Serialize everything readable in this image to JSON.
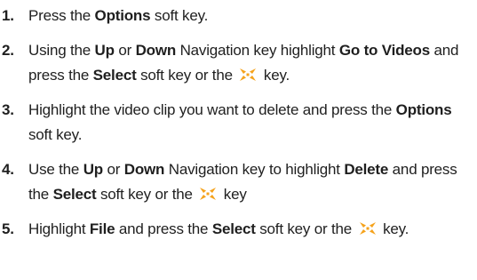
{
  "steps": [
    {
      "number": "1.",
      "parts": [
        {
          "t": "Press the "
        },
        {
          "t": "Options",
          "b": true
        },
        {
          "t": " soft key."
        }
      ]
    },
    {
      "number": "2.",
      "parts": [
        {
          "t": "Using the "
        },
        {
          "t": "Up",
          "b": true
        },
        {
          "t": " or "
        },
        {
          "t": "Down",
          "b": true
        },
        {
          "t": " Navigation key highlight "
        },
        {
          "t": "Go to Videos",
          "b": true
        },
        {
          "t": " and press the "
        },
        {
          "t": "Select",
          "b": true
        },
        {
          "t": " soft key or the "
        },
        {
          "icon": "nav-key-icon"
        },
        {
          "t": " key."
        }
      ]
    },
    {
      "number": "3.",
      "parts": [
        {
          "t": "Highlight the video clip you want to delete and press the "
        },
        {
          "t": "Options",
          "b": true
        },
        {
          "t": " soft key."
        }
      ]
    },
    {
      "number": "4.",
      "parts": [
        {
          "t": "Use the "
        },
        {
          "t": "Up",
          "b": true
        },
        {
          "t": " or "
        },
        {
          "t": "Down",
          "b": true
        },
        {
          "t": " Navigation key to highlight "
        },
        {
          "t": "Delete",
          "b": true
        },
        {
          "t": " and press the "
        },
        {
          "t": "Select",
          "b": true
        },
        {
          "t": " soft key or the "
        },
        {
          "icon": "nav-key-icon"
        },
        {
          "t": " key"
        }
      ]
    },
    {
      "number": "5.",
      "parts": [
        {
          "t": "Highlight "
        },
        {
          "t": "File",
          "b": true
        },
        {
          "t": " and press the "
        },
        {
          "t": "Select",
          "b": true
        },
        {
          "t": " soft key or the "
        },
        {
          "icon": "nav-key-icon"
        },
        {
          "t": " key."
        }
      ]
    }
  ],
  "icon_color": "#F5A21B"
}
